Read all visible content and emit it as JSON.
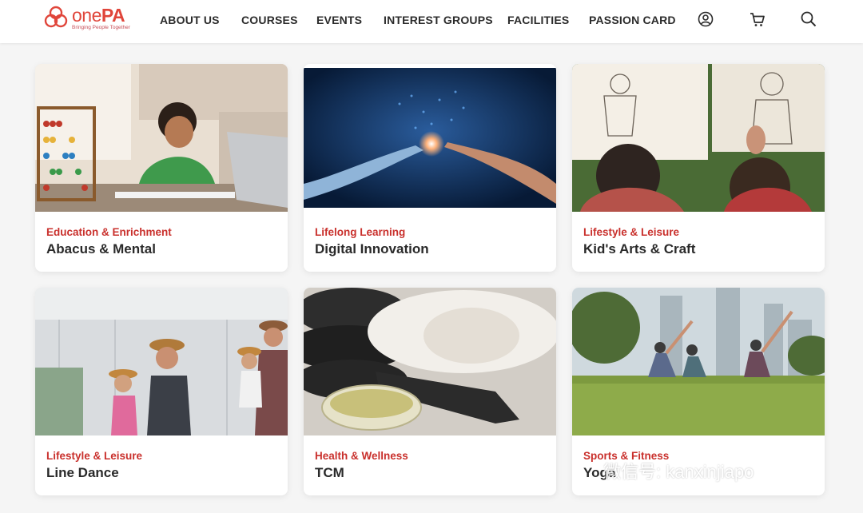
{
  "brand": {
    "name_part1": "one",
    "name_part2": "PA",
    "tagline": "Bringing People Together"
  },
  "nav": {
    "items": [
      "ABOUT US",
      "COURSES",
      "EVENTS",
      "INTEREST GROUPS",
      "FACILITIES",
      "PASSION CARD"
    ],
    "icons": [
      "user-icon",
      "cart-icon",
      "search-icon"
    ]
  },
  "courses": [
    {
      "category": "Education & Enrichment",
      "title": "Abacus & Mental"
    },
    {
      "category": "Lifelong Learning",
      "title": "Digital Innovation"
    },
    {
      "category": "Lifestyle & Leisure",
      "title": "Kid's Arts & Craft"
    },
    {
      "category": "Lifestyle & Leisure",
      "title": "Line Dance"
    },
    {
      "category": "Health & Wellness",
      "title": "TCM"
    },
    {
      "category": "Sports & Fitness",
      "title": "Yoga"
    }
  ],
  "watermark": {
    "text": "微信号: kanxinjiapo"
  },
  "colors": {
    "accent": "#c9302c",
    "brand": "#e0453a",
    "background": "#f5f5f5"
  }
}
